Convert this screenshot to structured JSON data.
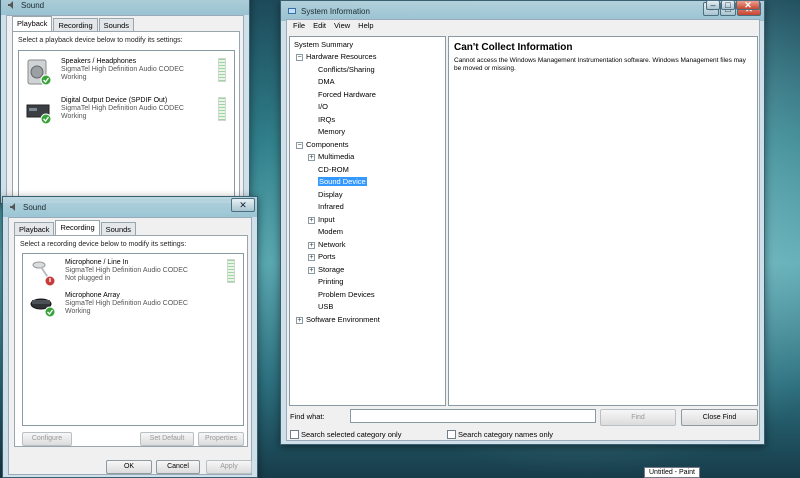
{
  "sound_playback": {
    "title": "Sound",
    "tabs": [
      "Playback",
      "Recording",
      "Sounds"
    ],
    "instruction": "Select a playback device below to modify its settings:",
    "devices": [
      {
        "name": "Speakers / Headphones",
        "driver": "SigmaTel High Definition Audio CODEC",
        "status": "Working"
      },
      {
        "name": "Digital Output Device (SPDIF Out)",
        "driver": "SigmaTel High Definition Audio CODEC",
        "status": "Working"
      }
    ]
  },
  "sound_recording": {
    "title": "Sound",
    "tabs": [
      "Playback",
      "Recording",
      "Sounds"
    ],
    "instruction": "Select a recording device below to modify its settings:",
    "devices": [
      {
        "name": "Microphone / Line In",
        "driver": "SigmaTel High Definition Audio CODEC",
        "status": "Not plugged in"
      },
      {
        "name": "Microphone Array",
        "driver": "SigmaTel High Definition Audio CODEC",
        "status": "Working"
      }
    ],
    "buttons": {
      "configure": "Configure",
      "set_default": "Set Default",
      "properties": "Properties",
      "ok": "OK",
      "cancel": "Cancel",
      "apply": "Apply"
    }
  },
  "sysinfo": {
    "title": "System Information",
    "menu": [
      "File",
      "Edit",
      "View",
      "Help"
    ],
    "tree": [
      "System Summary",
      "Hardware Resources",
      "Conflicts/Sharing",
      "DMA",
      "Forced Hardware",
      "I/O",
      "IRQs",
      "Memory",
      "Components",
      "Multimedia",
      "CD-ROM",
      "Sound Device",
      "Display",
      "Infrared",
      "Input",
      "Modem",
      "Network",
      "Ports",
      "Storage",
      "Printing",
      "Problem Devices",
      "USB",
      "Software Environment"
    ],
    "error_title": "Can't Collect Information",
    "error_body": "Cannot access the Windows Management Instrumentation software. Windows Management files may be moved or missing.",
    "find_what_label": "Find what:",
    "find_value": "",
    "find_button": "Find",
    "close_find_button": "Close Find",
    "search_selected_label": "Search selected category only",
    "search_names_label": "Search category names only"
  },
  "taskbar_tooltip": "Untitled - Paint"
}
